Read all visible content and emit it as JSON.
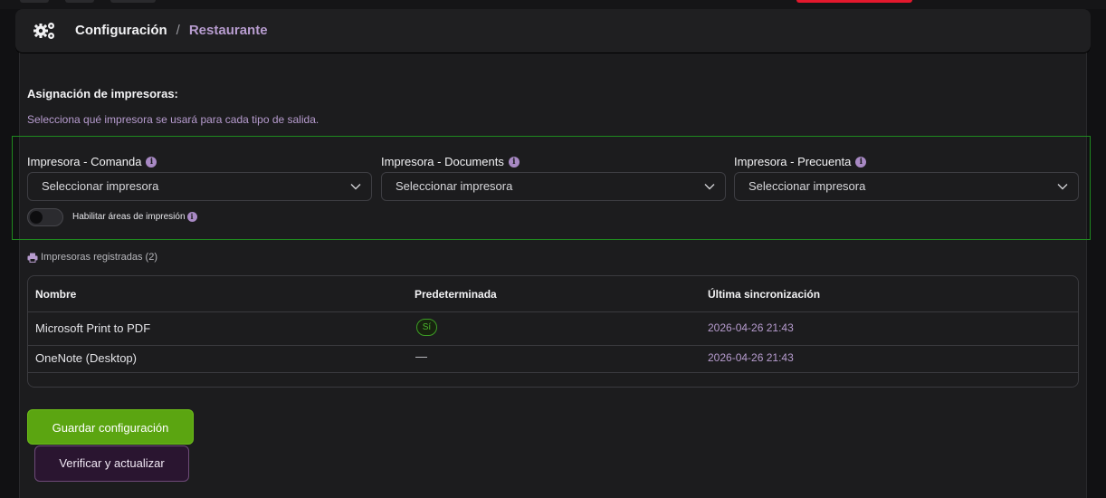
{
  "breadcrumb": {
    "section": "Configuración",
    "separator": "/",
    "current": "Restaurante"
  },
  "assignment": {
    "title": "Asignación de impresoras:",
    "subtitle": "Selecciona qué impresora se usará para cada tipo de salida.",
    "fields": [
      {
        "label": "Impresora - Comanda",
        "value": "Seleccionar impresora"
      },
      {
        "label": "Impresora - Documents",
        "value": "Seleccionar impresora"
      },
      {
        "label": "Impresora - Precuenta",
        "value": "Seleccionar impresora"
      }
    ],
    "toggle_label": "Habilitar áreas de impresión",
    "toggle_on": false
  },
  "printers": {
    "title": "Impresoras registradas (2)",
    "columns": [
      "Nombre",
      "Predeterminada",
      "Última sincronización"
    ],
    "rows": [
      {
        "name": "Microsoft Print to PDF",
        "default": "Sí",
        "synced": "2026-04-26 21:43"
      },
      {
        "name": "OneNote (Desktop)",
        "default": "—",
        "synced": "2026-04-26 21:43"
      }
    ]
  },
  "actions": {
    "save_label": "Guardar configuración",
    "verify_label": "Verificar y actualizar"
  },
  "colors": {
    "accent_purple": "#b79ccf",
    "success_green": "#5ba511",
    "highlight_border": "#1f8a1f"
  },
  "icons": {
    "header": "gears-icon",
    "info": "info-icon",
    "dropdown": "chevron-down-icon",
    "printer": "printer-icon"
  }
}
